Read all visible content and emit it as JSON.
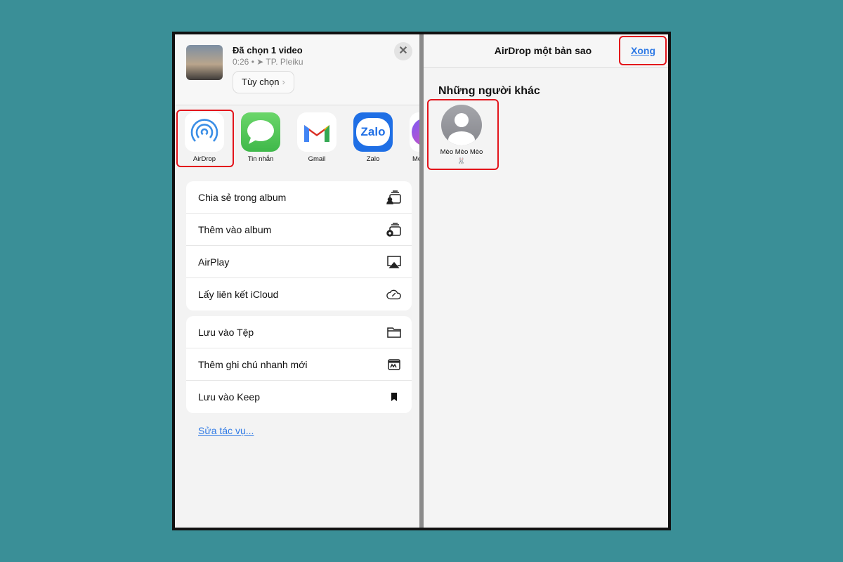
{
  "share_sheet": {
    "title": "Đã chọn 1 video",
    "duration": "0:26",
    "location": "TP. Pleiku",
    "options_label": "Tùy chọn",
    "apps": [
      {
        "label": "AirDrop",
        "icon": "airdrop-icon"
      },
      {
        "label": "Tin nhắn",
        "icon": "messages-icon"
      },
      {
        "label": "Gmail",
        "icon": "gmail-icon"
      },
      {
        "label": "Zalo",
        "icon": "zalo-icon"
      },
      {
        "label": "Me",
        "icon": "messenger-icon"
      }
    ],
    "zalo_logo_text": "Zalo",
    "actions_group1": [
      {
        "label": "Chia sẻ trong album",
        "icon": "shared-album-icon"
      },
      {
        "label": "Thêm vào album",
        "icon": "add-album-icon"
      },
      {
        "label": "AirPlay",
        "icon": "airplay-icon"
      },
      {
        "label": "Lấy liên kết iCloud",
        "icon": "icloud-link-icon"
      }
    ],
    "actions_group2": [
      {
        "label": "Lưu vào Tệp",
        "icon": "folder-icon"
      },
      {
        "label": "Thêm ghi chú nhanh mới",
        "icon": "quick-note-icon"
      },
      {
        "label": "Lưu vào Keep",
        "icon": "bookmark-icon"
      }
    ],
    "edit_actions_label": "Sửa tác vụ..."
  },
  "airdrop": {
    "title": "AirDrop một bản sao",
    "done_label": "Xong",
    "section_title": "Những người khác",
    "people": [
      {
        "name": "Mèo Mèo Mèo",
        "sub": "🐰"
      }
    ]
  },
  "colors": {
    "background": "#3a8f97",
    "highlight": "#e3141b",
    "link": "#2f7ae5"
  }
}
